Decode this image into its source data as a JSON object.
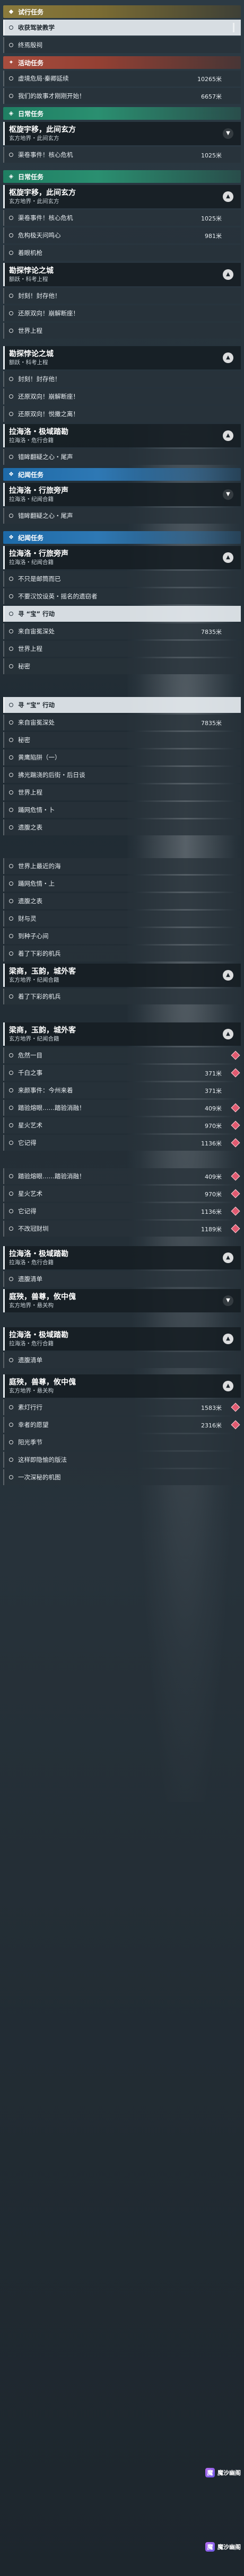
{
  "sections": {
    "trial": "试行任务",
    "event": "活动任务",
    "daily": "日常任务",
    "wandering": "纪闻任务"
  },
  "block1": {
    "items": [
      {
        "label": "收获驾驶教学",
        "selected": true
      },
      {
        "label": "终焉殷祠"
      }
    ],
    "event_items": [
      {
        "label": "虚境危局·秦卿延续",
        "value": "10265米"
      },
      {
        "label": "我们的故事才刚刚开始！",
        "value": "6657米"
      }
    ]
  },
  "quest_a": {
    "title": "枢旋宇移，此间玄方",
    "sub": "玄方地界・此间玄方"
  },
  "quest_a_items": [
    {
      "label": "渠卷事件！核心危机",
      "value": "1025米"
    }
  ],
  "quest_a2_items": [
    {
      "label": "渠卷事件！核心危机",
      "value": "1025米"
    },
    {
      "label": "危构极天问鸣心",
      "value": "981米"
    },
    {
      "label": "着眼机枪"
    }
  ],
  "quest_b": {
    "title": "勘探悖论之城",
    "sub": "额跃・科考上程"
  },
  "quest_b_items": [
    {
      "label": "封刻！封存他！"
    },
    {
      "label": "还原双向！崩解断座！"
    },
    {
      "label": "世界上程"
    }
  ],
  "quest_b2_items": [
    {
      "label": "封刻！封存他！"
    },
    {
      "label": "还原双向！崩解断座！"
    },
    {
      "label": "还原双向！悦撒之离！"
    }
  ],
  "quest_c": {
    "title": "拉海洛・极域踏勘",
    "sub": "拉海洛・危行合籍"
  },
  "quest_c_items": [
    {
      "label": "错眸翻疑之心・尾声"
    }
  ],
  "quest_d": {
    "title": "拉海洛・行旅旁声",
    "sub": "拉海洛・纪闻合籍"
  },
  "quest_d_items": [
    {
      "label": "错眸翻疑之心・尾声"
    }
  ],
  "quest_e": {
    "title": "拉海洛・行旅旁声",
    "sub": "拉海洛・纪闻合籍"
  },
  "quest_e_items": [
    {
      "label": "不只是邮筒而已"
    },
    {
      "label": "不要汉饺设英・摇名的遗窃者"
    },
    {
      "label": "寻 “宝” 行动",
      "selected": true
    },
    {
      "label": "来自宙冕深处",
      "value": "7835米"
    },
    {
      "label": "世界上程"
    },
    {
      "label": "秘密"
    }
  ],
  "list2": [
    {
      "label": "寻 “宝” 行动",
      "selected": true
    },
    {
      "label": "来自宙冕深处",
      "value": "7835米"
    },
    {
      "label": "秘密"
    },
    {
      "label": "黄鹰陷阱（一）"
    },
    {
      "label": "拂光踹浇的后街・后日谈"
    },
    {
      "label": "世界上程"
    },
    {
      "label": "踊网危情・卜"
    },
    {
      "label": "遗腹之表"
    }
  ],
  "list3": [
    {
      "label": "世界上最近的海"
    },
    {
      "label": "踊网危情・上"
    },
    {
      "label": "遗腹之表"
    },
    {
      "label": "财与灵"
    },
    {
      "label": "到种子心间"
    },
    {
      "label": "着了下彩的机兵"
    }
  ],
  "quest_f": {
    "title": "梁商，玉韵，城外客",
    "sub": "玄方地界・纪闻合籍"
  },
  "quest_f_items": [
    {
      "label": "着了下彩的机兵"
    }
  ],
  "quest_g": {
    "title": "梁商，玉韵，城外客",
    "sub": "玄方地界・纪闻合籍"
  },
  "quest_g_items": [
    {
      "label": "危然一目"
    },
    {
      "label": "千白之事",
      "value": "371米"
    },
    {
      "label": "来颜事件：今州来着",
      "value": "371米"
    },
    {
      "label": "踏验熔眼……踏验消融！",
      "value": "409米"
    },
    {
      "label": "星火艺术",
      "value": "970米"
    },
    {
      "label": "它记得",
      "value": "1136米"
    }
  ],
  "list4": [
    {
      "label": "踏验熔眼……踏验消融！",
      "value": "409米"
    },
    {
      "label": "星火艺术",
      "value": "970米"
    },
    {
      "label": "它记得",
      "value": "1136米"
    },
    {
      "label": "不改冠财圳",
      "value": "1189米"
    }
  ],
  "quest_h": {
    "title": "拉海洛・极域踏勘",
    "sub": "拉海洛・危行合籍"
  },
  "quest_h_items": [
    {
      "label": "遗腹清单"
    }
  ],
  "quest_i": {
    "title": "庭殃，兽尊，攸中傀",
    "sub": "玄方地界・悬关构"
  },
  "quest_i2": {
    "title": "拉海洛・极域踏勘",
    "sub": "拉海洛・危行合籍"
  },
  "quest_i2_items": [
    {
      "label": "遗腹清单"
    }
  ],
  "quest_j": {
    "title": "庭殃，兽尊，攸中傀",
    "sub": "玄方地界・悬关构"
  },
  "quest_j_items": [
    {
      "label": "素灯行行",
      "value": "1583米"
    },
    {
      "label": "幸者的愿望",
      "value": "2316米"
    },
    {
      "label": "阳光季节"
    },
    {
      "label": "这样即隐愉的版法"
    },
    {
      "label": "一次深秘的机图"
    }
  ],
  "brand": {
    "name": "魔沙幽阁"
  }
}
